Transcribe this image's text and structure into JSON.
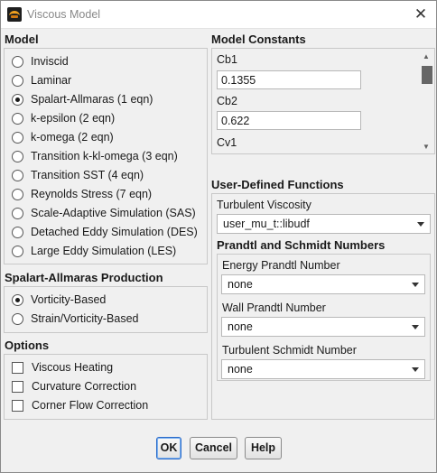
{
  "window": {
    "title": "Viscous Model"
  },
  "model": {
    "title": "Model",
    "options": [
      {
        "label": "Inviscid",
        "checked": false
      },
      {
        "label": "Laminar",
        "checked": false
      },
      {
        "label": "Spalart-Allmaras (1 eqn)",
        "checked": true
      },
      {
        "label": "k-epsilon (2 eqn)",
        "checked": false
      },
      {
        "label": "k-omega (2 eqn)",
        "checked": false
      },
      {
        "label": "Transition k-kl-omega (3 eqn)",
        "checked": false
      },
      {
        "label": "Transition SST (4 eqn)",
        "checked": false
      },
      {
        "label": "Reynolds Stress (7 eqn)",
        "checked": false
      },
      {
        "label": "Scale-Adaptive Simulation (SAS)",
        "checked": false
      },
      {
        "label": "Detached Eddy Simulation (DES)",
        "checked": false
      },
      {
        "label": "Large Eddy Simulation (LES)",
        "checked": false
      }
    ]
  },
  "production": {
    "title": "Spalart-Allmaras Production",
    "options": [
      {
        "label": "Vorticity-Based",
        "checked": true
      },
      {
        "label": "Strain/Vorticity-Based",
        "checked": false
      }
    ]
  },
  "options": {
    "title": "Options",
    "items": [
      {
        "label": "Viscous Heating",
        "checked": false
      },
      {
        "label": "Curvature Correction",
        "checked": false
      },
      {
        "label": "Corner Flow Correction",
        "checked": false
      }
    ]
  },
  "constants": {
    "title": "Model Constants",
    "items": [
      {
        "label": "Cb1",
        "value": "0.1355"
      },
      {
        "label": "Cb2",
        "value": "0.622"
      },
      {
        "label": "Cv1"
      }
    ]
  },
  "udf": {
    "title": "User-Defined Functions",
    "turbulent_viscosity_label": "Turbulent Viscosity",
    "turbulent_viscosity_value": "user_mu_t::libudf",
    "prandtl_title": "Prandtl and Schmidt Numbers",
    "fields": [
      {
        "label": "Energy Prandtl Number",
        "value": "none"
      },
      {
        "label": "Wall Prandtl Number",
        "value": "none"
      },
      {
        "label": "Turbulent Schmidt Number",
        "value": "none"
      }
    ]
  },
  "buttons": {
    "ok": "OK",
    "cancel": "Cancel",
    "help": "Help"
  }
}
